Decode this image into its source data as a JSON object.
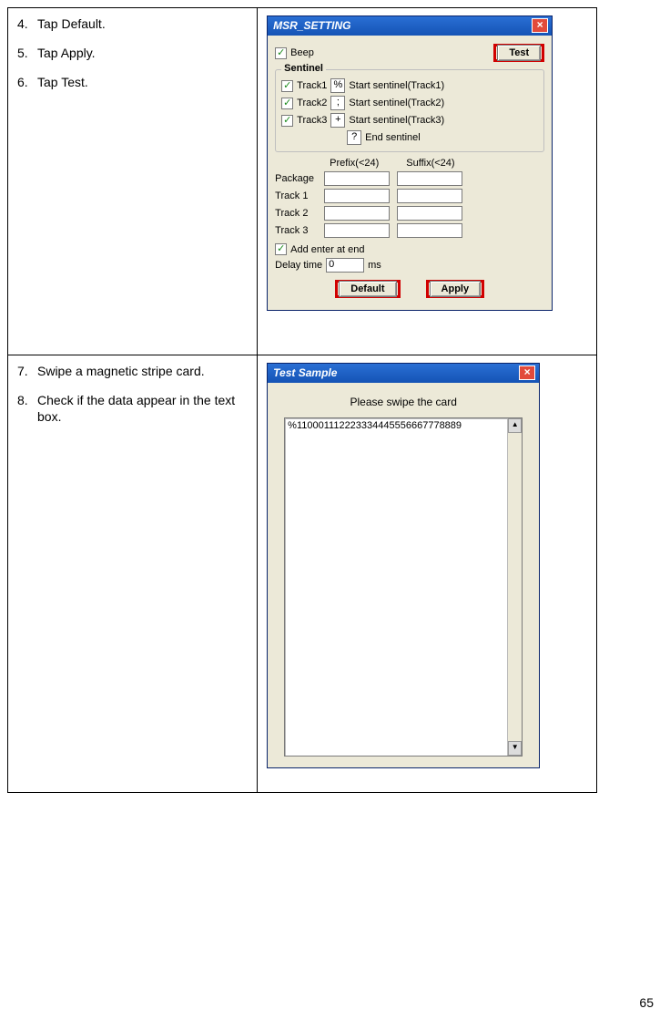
{
  "page_number": "65",
  "rows": [
    {
      "instructions": [
        {
          "n": "4.",
          "text": "Tap Default."
        },
        {
          "n": "5.",
          "text": "Tap Apply."
        },
        {
          "n": "6.",
          "text": "Tap Test."
        }
      ]
    },
    {
      "instructions": [
        {
          "n": "7.",
          "text": "Swipe a magnetic stripe card."
        },
        {
          "n": "8.",
          "text": "Check if the data appear in the text box."
        }
      ]
    }
  ],
  "msr_setting": {
    "title": "MSR_SETTING",
    "beep_label": "Beep",
    "test_button": "Test",
    "sentinel_legend": "Sentinel",
    "tracks": [
      {
        "chk_label": "Track1",
        "val": "%",
        "start_label": "Start sentinel(Track1)"
      },
      {
        "chk_label": "Track2",
        "val": ";",
        "start_label": "Start sentinel(Track2)"
      },
      {
        "chk_label": "Track3",
        "val": "+",
        "start_label": "Start sentinel(Track3)"
      }
    ],
    "end_sentinel_val": "?",
    "end_sentinel_label": "End sentinel",
    "prefix_header": "Prefix(<24)",
    "suffix_header": "Suffix(<24)",
    "pfields": [
      "Package",
      "Track 1",
      "Track 2",
      "Track 3"
    ],
    "add_enter_label": "Add enter at end",
    "delay_label": "Delay time",
    "delay_value": "0",
    "delay_unit": "ms",
    "default_button": "Default",
    "apply_button": "Apply"
  },
  "test_sample": {
    "title": "Test Sample",
    "message": "Please swipe the card",
    "data": "%110001112223334445556667778889"
  }
}
